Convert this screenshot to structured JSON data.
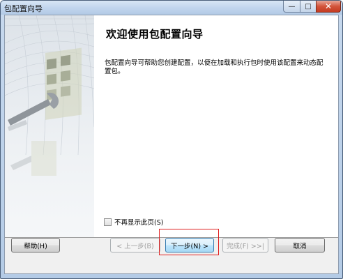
{
  "window": {
    "title": "包配置向导",
    "controls": {
      "minimize": "—",
      "maximize": "□",
      "close": "✕"
    }
  },
  "main": {
    "heading": "欢迎使用包配置向导",
    "description": "包配置向导可帮助您创建配置，以便在加载和执行包时使用该配置来动态配置包。"
  },
  "checkbox": {
    "label": "不再显示此页(S)",
    "checked": false
  },
  "buttons": {
    "help": "帮助(H)",
    "back": "< 上一步(B)",
    "next": "下一步(N) >",
    "finish": "完成(F) >>|",
    "cancel": "取消"
  },
  "colors": {
    "highlight": "#e02020",
    "title_bar": "#c2d6ee",
    "close": "#c43a20"
  }
}
